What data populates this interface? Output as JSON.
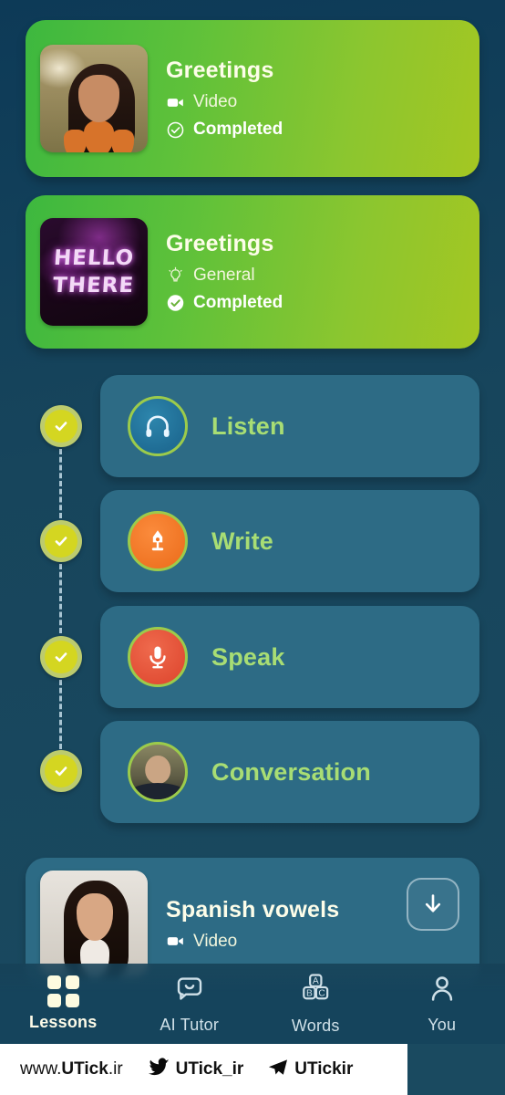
{
  "colors": {
    "background": "#17455c",
    "card_green_start": "#3db83f",
    "card_green_end": "#a4c722",
    "card_blue": "#2d6b85",
    "accent_green_text": "#a8dd74",
    "rail_dot": "#d4d621",
    "ring_green": "#9ccb4b",
    "icon_listen": "#1f6c94",
    "icon_write": "#ef7322",
    "icon_speak": "#e14d34"
  },
  "completed_lessons": [
    {
      "title": "Greetings",
      "type_label": "Video",
      "type_icon": "video-camera-icon",
      "status_label": "Completed",
      "status_icon": "check-circle-outline-icon",
      "thumbnail": "woman-orange-blazer-thumbnail"
    },
    {
      "title": "Greetings",
      "type_label": "General",
      "type_icon": "lightbulb-icon",
      "status_label": "Completed",
      "status_icon": "check-circle-filled-icon",
      "thumbnail": "hello-there-neon-thumbnail",
      "thumbnail_text": [
        "HELLO",
        "THERE"
      ]
    }
  ],
  "activities": [
    {
      "label": "Listen",
      "icon": "headphones-icon",
      "completed": true
    },
    {
      "label": "Write",
      "icon": "pen-nib-icon",
      "completed": true
    },
    {
      "label": "Speak",
      "icon": "microphone-icon",
      "completed": true
    },
    {
      "label": "Conversation",
      "icon": "person-avatar-icon",
      "completed": true
    }
  ],
  "next_lesson": {
    "title": "Spanish vowels",
    "type_label": "Video",
    "type_icon": "video-camera-icon",
    "download_icon": "download-arrow-icon",
    "thumbnail": "woman-light-background-thumbnail"
  },
  "bottom_nav": {
    "items": [
      {
        "label": "Lessons",
        "icon": "grid-squares-icon",
        "active": true
      },
      {
        "label": "AI Tutor",
        "icon": "chat-bubble-smile-icon",
        "active": false
      },
      {
        "label": "Words",
        "icon": "abc-blocks-icon",
        "active": false
      },
      {
        "label": "You",
        "icon": "person-icon",
        "active": false
      }
    ]
  },
  "footer": {
    "site_prefix": "www.",
    "site_brand": "UTick",
    "site_suffix": ".ir",
    "twitter_handle": "UTick_ir",
    "twitter_icon": "twitter-bird-icon",
    "telegram_handle": "UTickir",
    "telegram_icon": "telegram-plane-icon"
  }
}
